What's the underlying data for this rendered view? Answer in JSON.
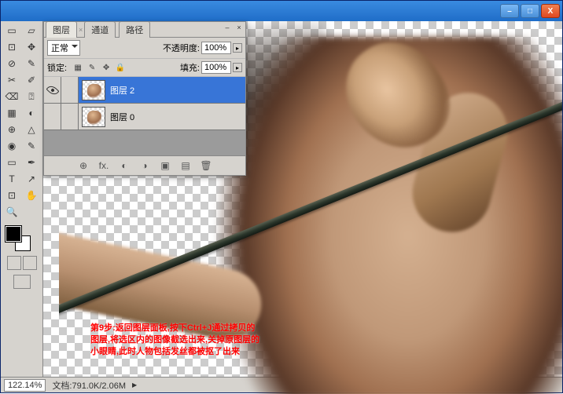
{
  "titlebar": {
    "minimize": "–",
    "maximize": "□",
    "close": "X"
  },
  "layers_panel": {
    "tabs": {
      "layers": "图层",
      "channels": "通道",
      "paths": "路径"
    },
    "blend_mode": "正常",
    "opacity_label": "不透明度:",
    "opacity_value": "100%",
    "lock_label": "锁定:",
    "fill_label": "填充:",
    "fill_value": "100%",
    "layers": [
      {
        "name": "图层 2",
        "visible": true,
        "selected": true
      },
      {
        "name": "图层 0",
        "visible": false,
        "selected": false
      }
    ]
  },
  "instruction": {
    "line1": "第9步:返回图层面板,按下Ctrl+J通过拷贝的",
    "line2": "图层,将选区内的图像截选出来,关掉原图层的",
    "line3": "小眼睛,此时人物包括发丝都被抠了出来"
  },
  "statusbar": {
    "zoom": "122.14%",
    "doc_label": "文档:",
    "doc_size": "791.0K/2.06M"
  },
  "tools": [
    "▭",
    "▱",
    "⊡",
    "✥",
    "⊘",
    "✎",
    "✂",
    "✐",
    "⌫",
    "⍰",
    "▦",
    "◐",
    "⊕",
    "△",
    "◉",
    "✎",
    "▭",
    "✒",
    "⬚",
    "T",
    "↗",
    "⊡",
    "✋",
    "🔍"
  ]
}
